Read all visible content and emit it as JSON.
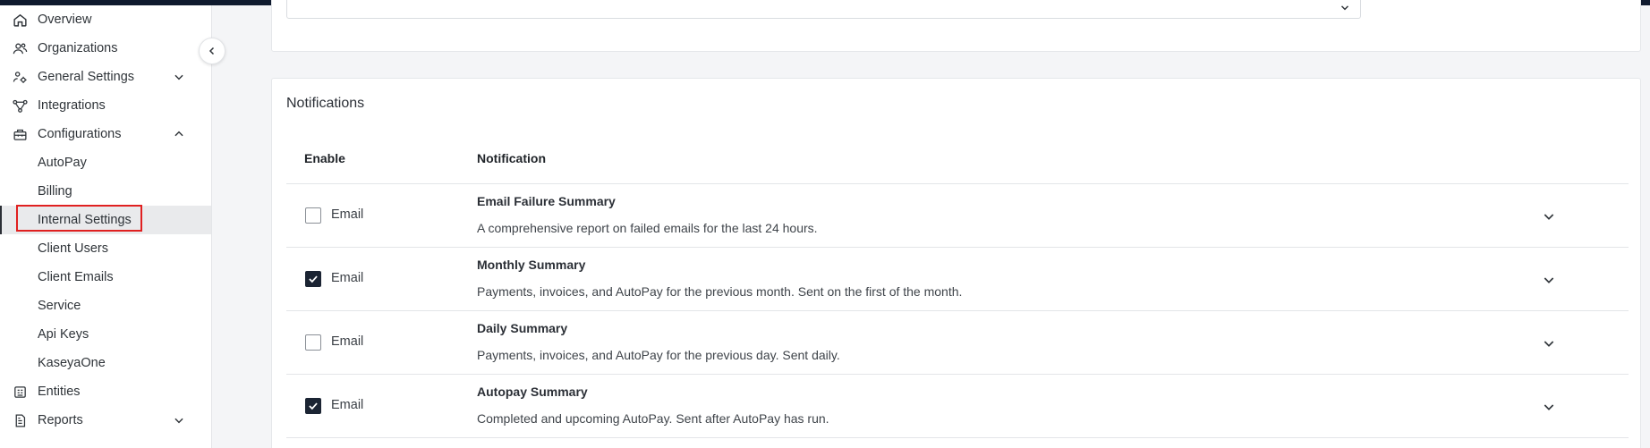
{
  "sidebar": {
    "items": [
      {
        "label": "Overview",
        "icon": "home-icon"
      },
      {
        "label": "Organizations",
        "icon": "users-icon"
      },
      {
        "label": "General Settings",
        "icon": "people-settings-icon",
        "expanded": false
      },
      {
        "label": "Integrations",
        "icon": "integrations-icon"
      },
      {
        "label": "Configurations",
        "icon": "toolbox-icon",
        "expanded": true
      },
      {
        "label": "AutoPay"
      },
      {
        "label": "Billing"
      },
      {
        "label": "Internal Settings",
        "active": true
      },
      {
        "label": "Client Users"
      },
      {
        "label": "Client Emails"
      },
      {
        "label": "Service"
      },
      {
        "label": "Api Keys"
      },
      {
        "label": "KaseyaOne"
      },
      {
        "label": "Entities",
        "icon": "entities-icon"
      },
      {
        "label": "Reports",
        "icon": "report-icon",
        "expanded": false
      }
    ]
  },
  "notifications": {
    "title": "Notifications",
    "columns": {
      "enable": "Enable",
      "notification": "Notification"
    },
    "rows": [
      {
        "checkbox_label": "Email",
        "checked": false,
        "title": "Email Failure Summary",
        "description": "A comprehensive report on failed emails for the last 24 hours."
      },
      {
        "checkbox_label": "Email",
        "checked": true,
        "title": "Monthly Summary",
        "description": "Payments, invoices, and AutoPay for the previous month. Sent on the first of the month."
      },
      {
        "checkbox_label": "Email",
        "checked": false,
        "title": "Daily Summary",
        "description": "Payments, invoices, and AutoPay for the previous day. Sent daily."
      },
      {
        "checkbox_label": "Email",
        "checked": true,
        "title": "Autopay Summary",
        "description": "Completed and upcoming AutoPay. Sent after AutoPay has run."
      }
    ]
  },
  "colors": {
    "highlight": "#e02020",
    "checkbox_checked": "#1b2433",
    "topbar": "#0f1a2e"
  }
}
